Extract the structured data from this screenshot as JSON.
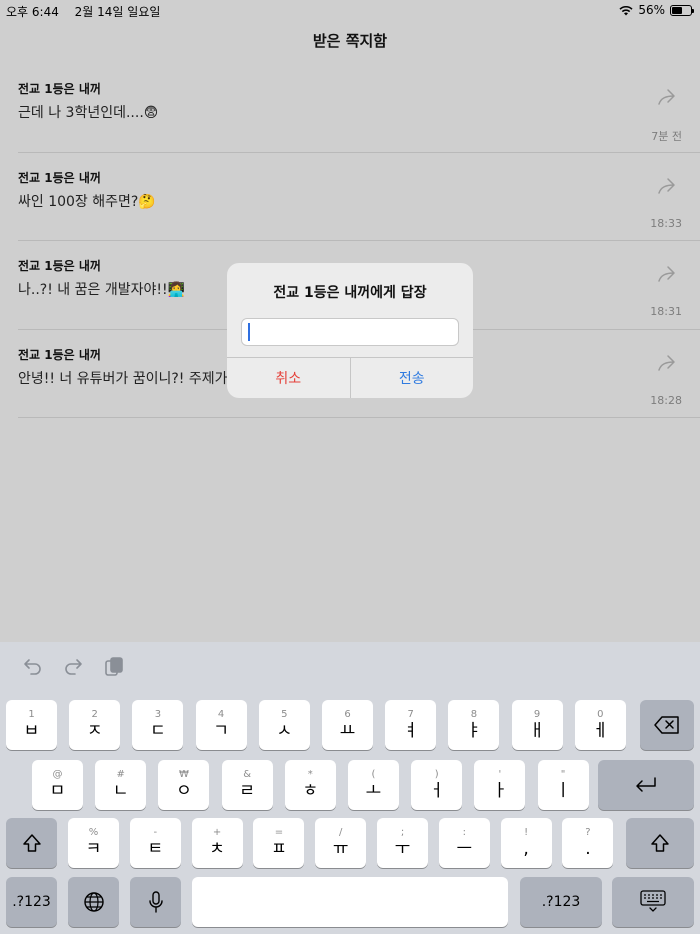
{
  "status": {
    "time": "오후 6:44",
    "date": "2월 14일 일요일",
    "battery": "56%",
    "battery_fraction": 0.56
  },
  "header": {
    "title": "받은 쪽지함"
  },
  "messages": [
    {
      "sender": "전교 1등은 내꺼",
      "text": "근데 나 3학년인데....😨",
      "time": "7분 전"
    },
    {
      "sender": "전교 1등은 내꺼",
      "text": "싸인 100장 해주면?🤔",
      "time": "18:33"
    },
    {
      "sender": "전교 1등은 내꺼",
      "text": "나..?! 내 꿈은 개발자야!!👩‍💻",
      "time": "18:31"
    },
    {
      "sender": "전교 1등은 내꺼",
      "text": "안녕!! 너 유튜버가 꿈이니?! 주제가 뭐",
      "time": "18:28"
    }
  ],
  "dialog": {
    "title": "전교 1등은 내꺼에게 답장",
    "input_value": "",
    "cancel": "취소",
    "send": "전송"
  },
  "keyboard": {
    "row1": [
      {
        "hint": "1",
        "main": "ㅂ"
      },
      {
        "hint": "2",
        "main": "ㅈ"
      },
      {
        "hint": "3",
        "main": "ㄷ"
      },
      {
        "hint": "4",
        "main": "ㄱ"
      },
      {
        "hint": "5",
        "main": "ㅅ"
      },
      {
        "hint": "6",
        "main": "ㅛ"
      },
      {
        "hint": "7",
        "main": "ㅕ"
      },
      {
        "hint": "8",
        "main": "ㅑ"
      },
      {
        "hint": "9",
        "main": "ㅐ"
      },
      {
        "hint": "0",
        "main": "ㅔ"
      }
    ],
    "row2": [
      {
        "hint": "@",
        "main": "ㅁ"
      },
      {
        "hint": "#",
        "main": "ㄴ"
      },
      {
        "hint": "₩",
        "main": "ㅇ"
      },
      {
        "hint": "&",
        "main": "ㄹ"
      },
      {
        "hint": "*",
        "main": "ㅎ"
      },
      {
        "hint": "(",
        "main": "ㅗ"
      },
      {
        "hint": ")",
        "main": "ㅓ"
      },
      {
        "hint": "'",
        "main": "ㅏ"
      },
      {
        "hint": "\"",
        "main": "ㅣ"
      }
    ],
    "row3": [
      {
        "hint": "%",
        "main": "ㅋ"
      },
      {
        "hint": "-",
        "main": "ㅌ"
      },
      {
        "hint": "+",
        "main": "ㅊ"
      },
      {
        "hint": "=",
        "main": "ㅍ"
      },
      {
        "hint": "/",
        "main": "ㅠ"
      },
      {
        "hint": ";",
        "main": "ㅜ"
      },
      {
        "hint": ":",
        "main": "ㅡ"
      },
      {
        "hint": "!",
        "main": ","
      },
      {
        "hint": "?",
        "main": "."
      }
    ],
    "numbers_label": ".?123"
  }
}
